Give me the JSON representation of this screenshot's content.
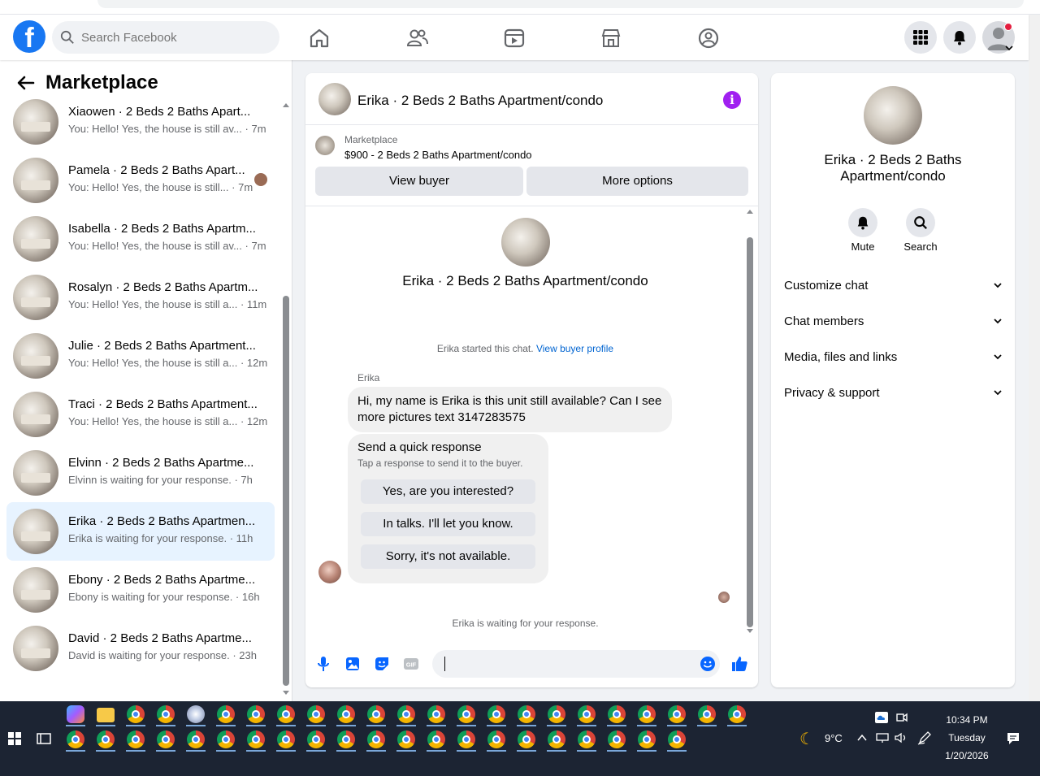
{
  "header": {
    "search_placeholder": "Search Facebook"
  },
  "sidebar": {
    "title": "Marketplace",
    "conversations": [
      {
        "name": "Xiaowen · 2 Beds 2 Baths Apart...",
        "snippet": "You: Hello! Yes, the house is still av... · 7m",
        "active": false,
        "mini_avatar": false
      },
      {
        "name": "Pamela · 2 Beds 2 Baths Apart...",
        "snippet": "You: Hello! Yes, the house is still... · 7m",
        "active": false,
        "mini_avatar": true
      },
      {
        "name": "Isabella · 2 Beds 2 Baths Apartm...",
        "snippet": "You: Hello! Yes, the house is still av... · 7m",
        "active": false,
        "mini_avatar": false
      },
      {
        "name": "Rosalyn · 2 Beds 2 Baths Apartm...",
        "snippet": "You: Hello! Yes, the house is still a... · 11m",
        "active": false,
        "mini_avatar": false
      },
      {
        "name": "Julie · 2 Beds 2 Baths Apartment...",
        "snippet": "You: Hello! Yes, the house is still a... · 12m",
        "active": false,
        "mini_avatar": false
      },
      {
        "name": "Traci · 2 Beds 2 Baths Apartment...",
        "snippet": "You: Hello! Yes, the house is still a... · 12m",
        "active": false,
        "mini_avatar": false
      },
      {
        "name": "Elvinn · 2 Beds 2 Baths Apartme...",
        "snippet": "Elvinn is waiting for your response. · 7h",
        "active": false,
        "mini_avatar": false
      },
      {
        "name": "Erika · 2 Beds 2 Baths Apartmen...",
        "snippet": "Erika is waiting for your response. · 11h",
        "active": true,
        "mini_avatar": false
      },
      {
        "name": "Ebony · 2 Beds 2 Baths Apartme...",
        "snippet": "Ebony is waiting for your response. · 16h",
        "active": false,
        "mini_avatar": false
      },
      {
        "name": "David · 2 Beds 2 Baths Apartme...",
        "snippet": "David is waiting for your response. · 23h",
        "active": false,
        "mini_avatar": false
      }
    ]
  },
  "chat": {
    "title": "Erika · 2 Beds 2 Baths Apartment/condo",
    "marketplace_label": "Marketplace",
    "listing": "$900 - 2 Beds 2 Baths Apartment/condo",
    "view_buyer": "View buyer",
    "more_options": "More options",
    "profile_name": "Erika · 2 Beds 2 Baths Apartment/condo",
    "started_text": "Erika started this chat.",
    "view_buyer_profile": "View buyer profile",
    "sender": "Erika",
    "message": "Hi, my name is Erika is this unit still available? Can I see more pictures text 3147283575",
    "quick_title": "Send a quick response",
    "quick_subtitle": "Tap a response to send it to the buyer.",
    "quick_replies": [
      "Yes, are you interested?",
      "In talks. I'll let you know.",
      "Sorry, it's not available."
    ],
    "waiting": "Erika is waiting for your response."
  },
  "details": {
    "name": "Erika · 2 Beds 2 Baths Apartment/condo",
    "mute": "Mute",
    "search": "Search",
    "rows": [
      "Customize chat",
      "Chat members",
      "Media, files and links",
      "Privacy & support"
    ]
  },
  "taskbar": {
    "weather": "9°C",
    "time": "10:34 PM",
    "day": "Tuesday",
    "date": "1/20/2026"
  },
  "colors": {
    "brand": "#1877f2",
    "active_row": "#e7f3ff",
    "info": "#a020f0"
  }
}
